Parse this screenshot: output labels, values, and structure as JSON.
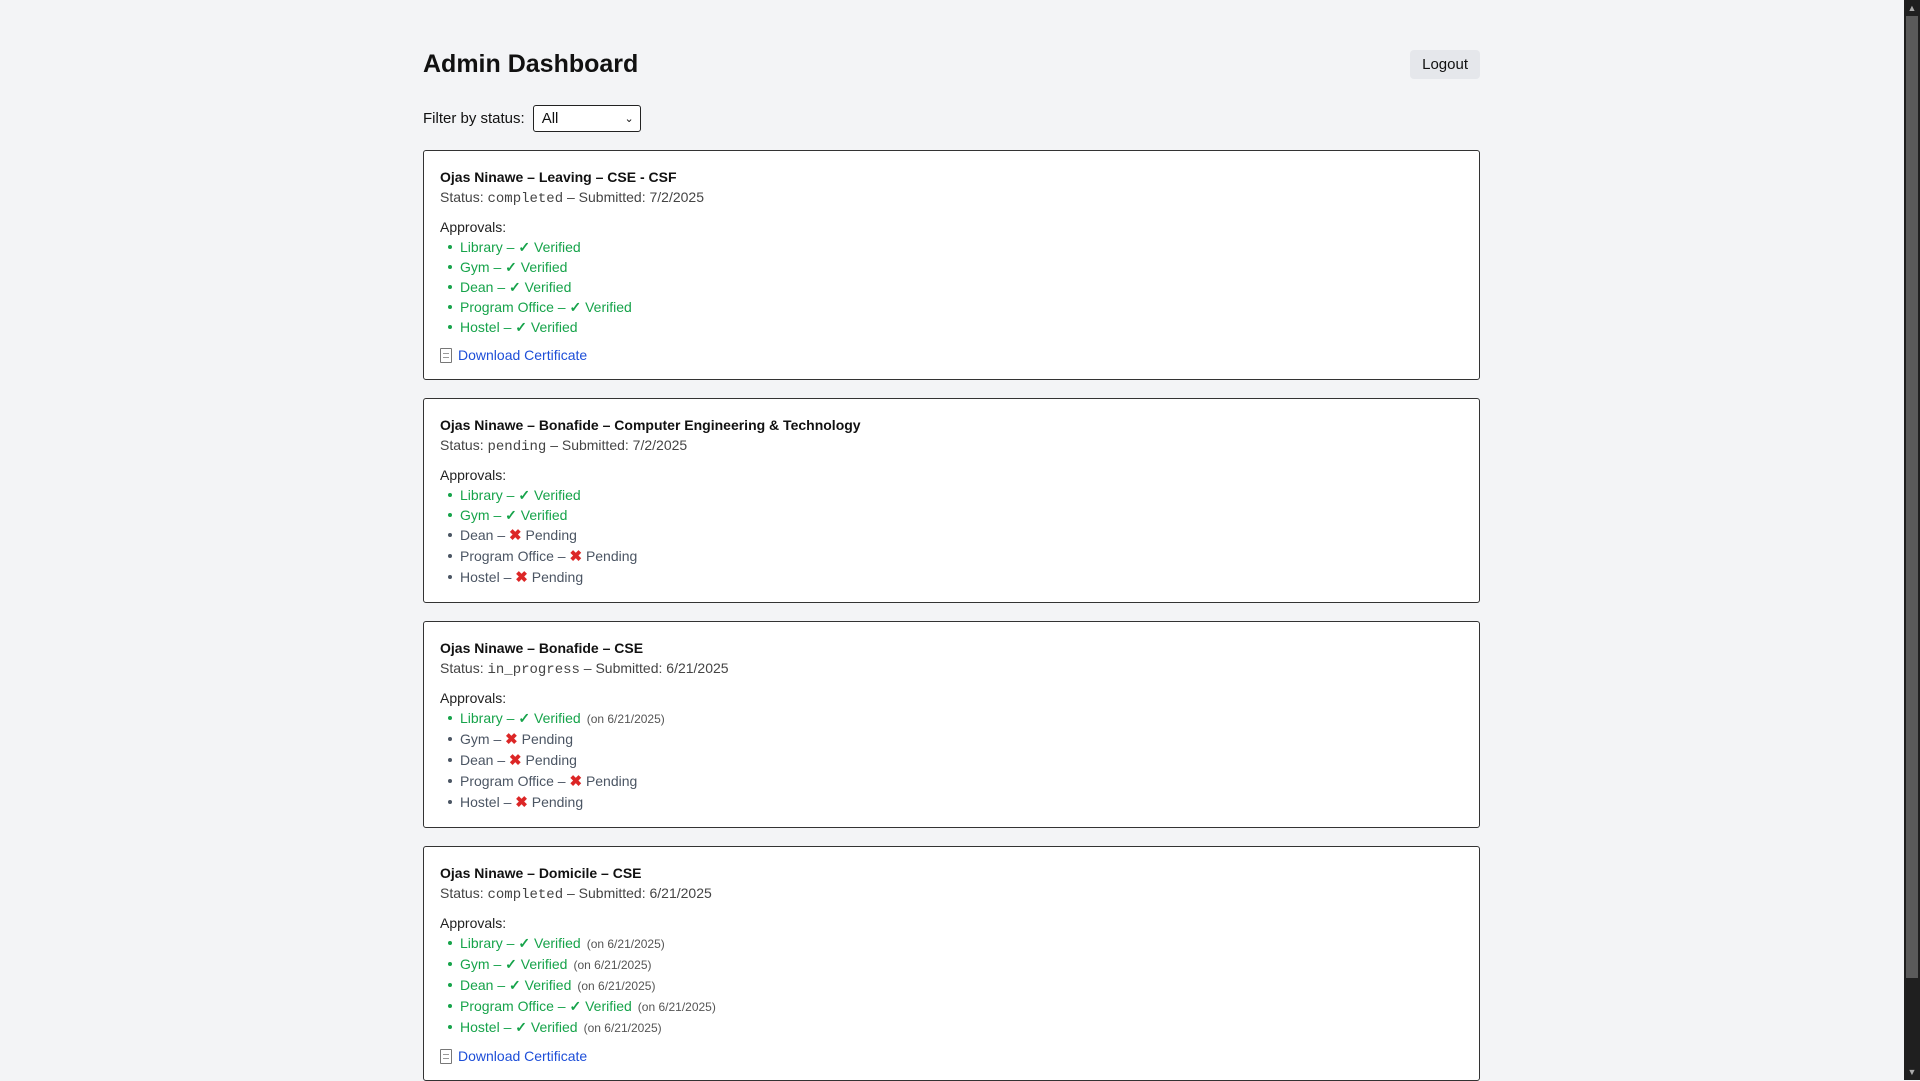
{
  "header": {
    "title": "Admin Dashboard",
    "logout_label": "Logout"
  },
  "filter": {
    "label": "Filter by status:",
    "selected": "All"
  },
  "approvals_label": "Approvals:",
  "colors": {
    "verified": "#16a34a",
    "pending": "#4b5563",
    "cross": "#dc2626",
    "link": "#1d4ed8"
  },
  "requests": [
    {
      "title": "Ojas Ninawe – Leaving – CSE - CSF",
      "status_prefix": "Status:",
      "status": "completed",
      "submitted": "– Submitted: 7/2/2025",
      "approvals": [
        {
          "dept": "Library",
          "state": "verified",
          "text": "Verified",
          "date": ""
        },
        {
          "dept": "Gym",
          "state": "verified",
          "text": "Verified",
          "date": ""
        },
        {
          "dept": "Dean",
          "state": "verified",
          "text": "Verified",
          "date": ""
        },
        {
          "dept": "Program Office",
          "state": "verified",
          "text": "Verified",
          "date": ""
        },
        {
          "dept": "Hostel",
          "state": "verified",
          "text": "Verified",
          "date": ""
        }
      ],
      "certificate_label": "Download Certificate"
    },
    {
      "title": "Ojas Ninawe – Bonafide – Computer Engineering & Technology",
      "status_prefix": "Status:",
      "status": "pending",
      "submitted": "– Submitted: 7/2/2025",
      "approvals": [
        {
          "dept": "Library",
          "state": "verified",
          "text": "Verified",
          "date": ""
        },
        {
          "dept": "Gym",
          "state": "verified",
          "text": "Verified",
          "date": ""
        },
        {
          "dept": "Dean",
          "state": "pending",
          "text": "Pending",
          "date": ""
        },
        {
          "dept": "Program Office",
          "state": "pending",
          "text": "Pending",
          "date": ""
        },
        {
          "dept": "Hostel",
          "state": "pending",
          "text": "Pending",
          "date": ""
        }
      ],
      "certificate_label": ""
    },
    {
      "title": "Ojas Ninawe – Bonafide – CSE",
      "status_prefix": "Status:",
      "status": "in_progress",
      "submitted": "– Submitted: 6/21/2025",
      "approvals": [
        {
          "dept": "Library",
          "state": "verified",
          "text": "Verified",
          "date": "(on 6/21/2025)"
        },
        {
          "dept": "Gym",
          "state": "pending",
          "text": "Pending",
          "date": ""
        },
        {
          "dept": "Dean",
          "state": "pending",
          "text": "Pending",
          "date": ""
        },
        {
          "dept": "Program Office",
          "state": "pending",
          "text": "Pending",
          "date": ""
        },
        {
          "dept": "Hostel",
          "state": "pending",
          "text": "Pending",
          "date": ""
        }
      ],
      "certificate_label": ""
    },
    {
      "title": "Ojas Ninawe – Domicile – CSE",
      "status_prefix": "Status:",
      "status": "completed",
      "submitted": "– Submitted: 6/21/2025",
      "approvals": [
        {
          "dept": "Library",
          "state": "verified",
          "text": "Verified",
          "date": "(on 6/21/2025)"
        },
        {
          "dept": "Gym",
          "state": "verified",
          "text": "Verified",
          "date": "(on 6/21/2025)"
        },
        {
          "dept": "Dean",
          "state": "verified",
          "text": "Verified",
          "date": "(on 6/21/2025)"
        },
        {
          "dept": "Program Office",
          "state": "verified",
          "text": "Verified",
          "date": "(on 6/21/2025)"
        },
        {
          "dept": "Hostel",
          "state": "verified",
          "text": "Verified",
          "date": "(on 6/21/2025)"
        }
      ],
      "certificate_label": "Download Certificate"
    }
  ]
}
